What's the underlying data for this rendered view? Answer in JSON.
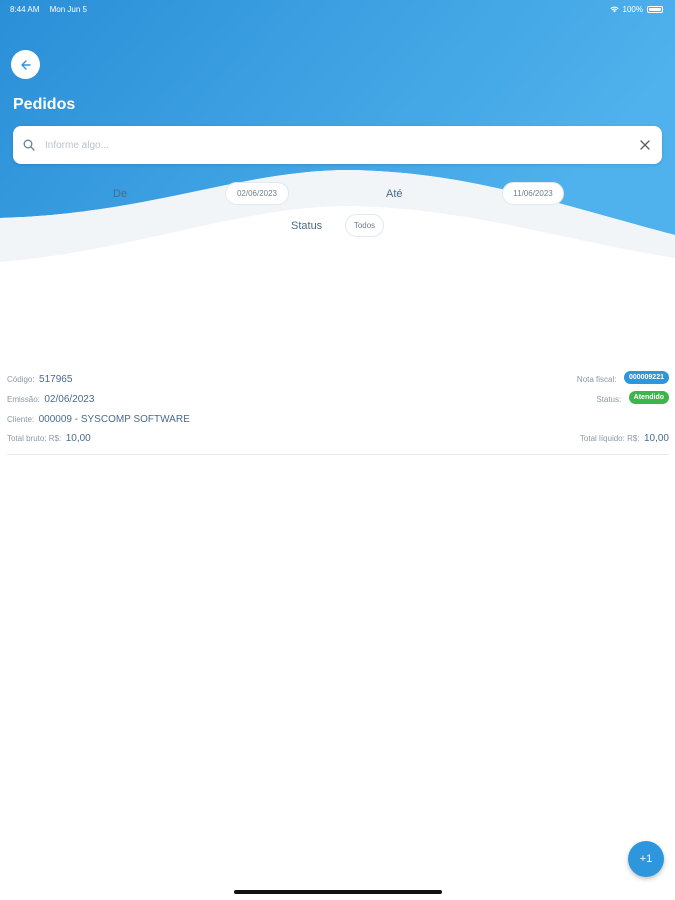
{
  "status_bar": {
    "time": "8:44 AM",
    "date": "Mon Jun 5",
    "battery": "100%"
  },
  "header": {
    "title": "Pedidos",
    "gradient_start": "#2b8fd8",
    "gradient_end": "#4fb2ec"
  },
  "search": {
    "placeholder": "Informe algo...",
    "value": ""
  },
  "filters": {
    "from_label": "De",
    "from_date": "02/06/2023",
    "to_label": "Até",
    "to_date": "11/06/2023",
    "status_label": "Status",
    "status_value": "Todos"
  },
  "orders": [
    {
      "code_label": "Código:",
      "code": "517965",
      "invoice_label": "Nota fiscal:",
      "invoice": "000009221",
      "invoice_color": "#2e96dd",
      "emission_label": "Emissão:",
      "emission": "02/06/2023",
      "status_label": "Status:",
      "status": "Atendido",
      "status_color": "#3cb54a",
      "client_label": "Cliente:",
      "client": "000009 - SYSCOMP SOFTWARE",
      "gross_label": "Total bruto: R$:",
      "gross": "10,00",
      "net_label": "Total líquido: R$:",
      "net": "10,00"
    }
  ],
  "fab": {
    "label": "+1"
  }
}
